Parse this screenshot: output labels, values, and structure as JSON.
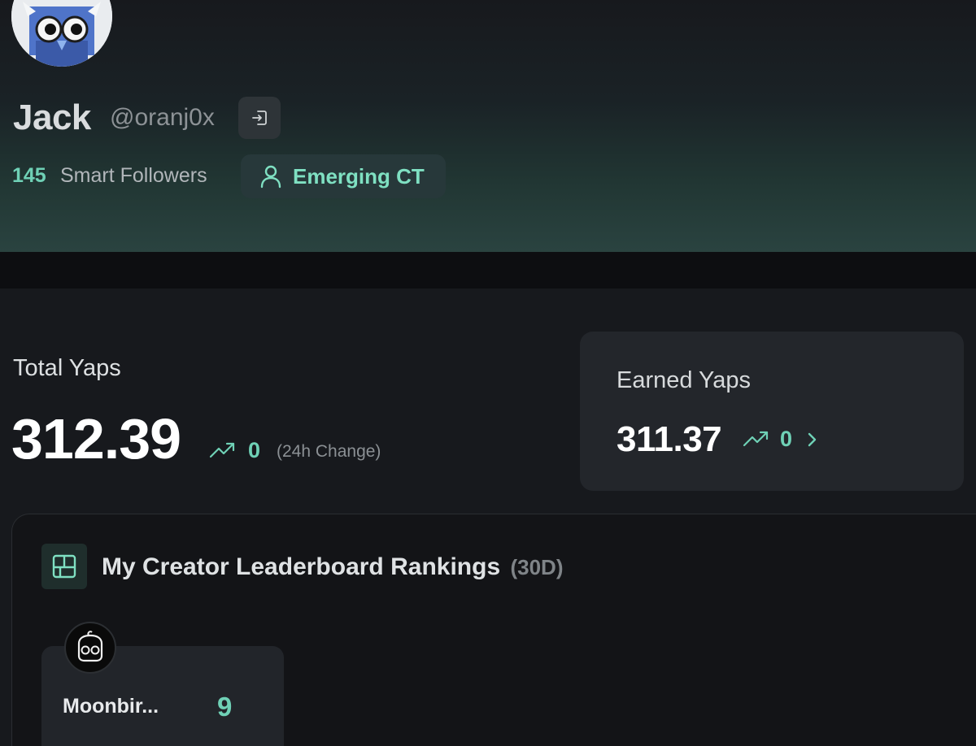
{
  "profile": {
    "name": "Jack",
    "handle": "@oranj0x",
    "smart_followers_count": "145",
    "smart_followers_label": "Smart Followers",
    "tier_label": "Emerging CT"
  },
  "total_yaps": {
    "label": "Total Yaps",
    "value": "312.39",
    "change": "0",
    "change_caption": "(24h Change)"
  },
  "earned_yaps": {
    "label": "Earned Yaps",
    "value": "311.37",
    "change": "0"
  },
  "leaderboard": {
    "title": "My Creator Leaderboard Rankings",
    "period": "(30D)",
    "items": [
      {
        "name": "Moonbir...",
        "rank": "9",
        "icon": "moonbirds-logo-icon"
      }
    ]
  },
  "colors": {
    "accent": "#6fd1b6",
    "background": "#15171b",
    "card": "#23262b"
  },
  "icons": {
    "switch_account": "logout-icon",
    "tier": "user-icon",
    "trend": "trending-up-icon",
    "chevron": "chevron-right-icon",
    "board": "layout-grid-icon"
  }
}
